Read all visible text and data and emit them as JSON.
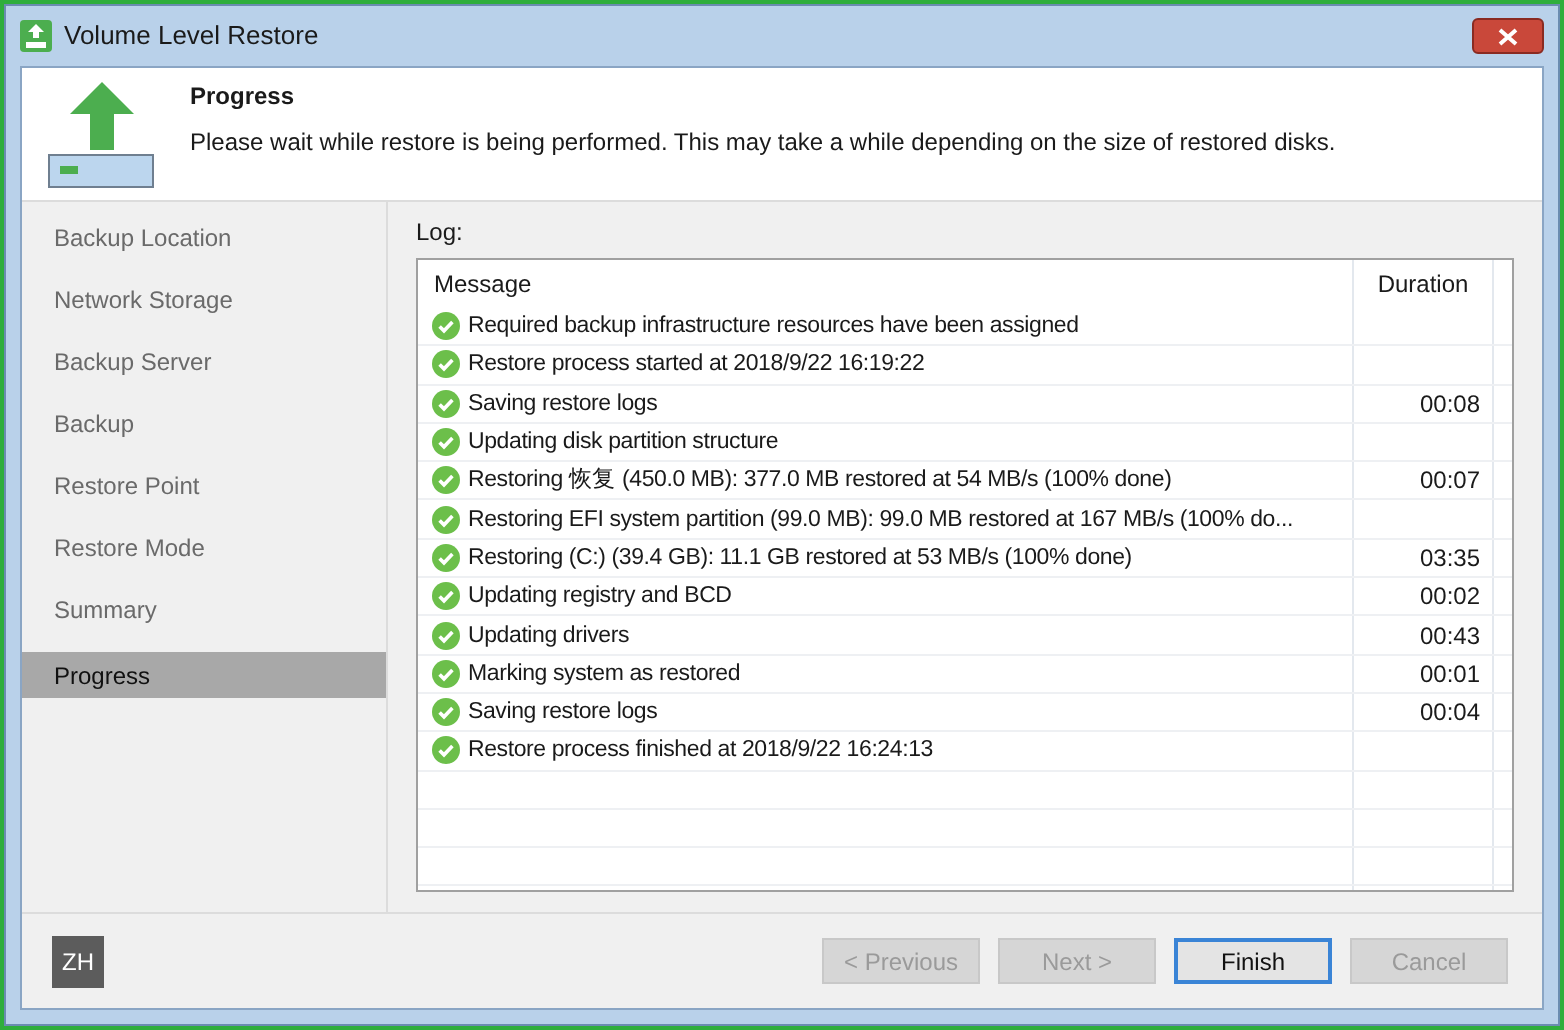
{
  "window": {
    "title": "Volume Level Restore"
  },
  "header": {
    "title": "Progress",
    "description": "Please wait while restore is being performed. This may take a while depending on the size of restored disks."
  },
  "sidebar": {
    "items": [
      {
        "label": "Backup Location",
        "selected": false
      },
      {
        "label": "Network Storage",
        "selected": false
      },
      {
        "label": "Backup Server",
        "selected": false
      },
      {
        "label": "Backup",
        "selected": false
      },
      {
        "label": "Restore Point",
        "selected": false
      },
      {
        "label": "Restore Mode",
        "selected": false
      },
      {
        "label": "Summary",
        "selected": false
      },
      {
        "label": "Progress",
        "selected": true
      }
    ]
  },
  "log": {
    "label": "Log:",
    "columns": [
      "Message",
      "Duration"
    ],
    "rows": [
      {
        "kind": "success",
        "message": "Required backup infrastructure resources have been assigned"
      },
      {
        "kind": "success",
        "message": "Restore process started at 2018/9/22 16:19:22"
      },
      {
        "kind": "success",
        "message": "Saving restore logs",
        "duration": "00:08"
      },
      {
        "kind": "success",
        "message": "Updating disk partition structure"
      },
      {
        "kind": "success",
        "message": "Restoring 恢复 (450.0 MB): 377.0 MB restored at 54 MB/s (100% done)",
        "duration": "00:07"
      },
      {
        "kind": "success",
        "message": "Restoring EFI system partition (99.0 MB): 99.0 MB restored at 167 MB/s (100% do..."
      },
      {
        "kind": "success",
        "message": "Restoring  (C:) (39.4 GB): 11.1 GB restored at 53 MB/s (100% done)",
        "duration": "03:35"
      },
      {
        "kind": "success",
        "message": "Updating registry and BCD",
        "duration": "00:02"
      },
      {
        "kind": "success",
        "message": "Updating drivers",
        "duration": "00:43"
      },
      {
        "kind": "success",
        "message": "Marking system as restored",
        "duration": "00:01"
      },
      {
        "kind": "success",
        "message": "Saving restore logs",
        "duration": "00:04"
      },
      {
        "kind": "success",
        "message": "Restore process finished at 2018/9/22 16:24:13"
      }
    ]
  },
  "footer": {
    "badge": "ZH",
    "buttons": [
      {
        "label": "< Previous",
        "disabled": true,
        "default": false
      },
      {
        "label": "Next >",
        "disabled": true,
        "default": false
      },
      {
        "label": "Finish",
        "disabled": false,
        "default": true
      },
      {
        "label": "Cancel",
        "disabled": true,
        "default": false
      }
    ]
  }
}
